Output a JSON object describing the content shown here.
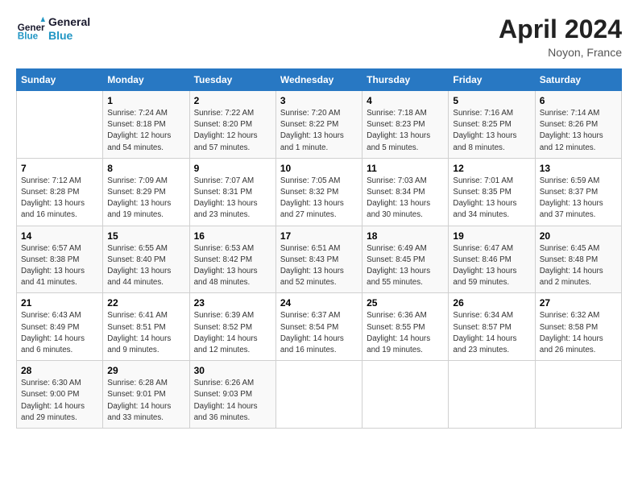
{
  "header": {
    "logo_line1": "General",
    "logo_line2": "Blue",
    "title": "April 2024",
    "subtitle": "Noyon, France"
  },
  "days_of_week": [
    "Sunday",
    "Monday",
    "Tuesday",
    "Wednesday",
    "Thursday",
    "Friday",
    "Saturday"
  ],
  "weeks": [
    [
      {
        "day": "",
        "info": ""
      },
      {
        "day": "1",
        "info": "Sunrise: 7:24 AM\nSunset: 8:18 PM\nDaylight: 12 hours\nand 54 minutes."
      },
      {
        "day": "2",
        "info": "Sunrise: 7:22 AM\nSunset: 8:20 PM\nDaylight: 12 hours\nand 57 minutes."
      },
      {
        "day": "3",
        "info": "Sunrise: 7:20 AM\nSunset: 8:22 PM\nDaylight: 13 hours\nand 1 minute."
      },
      {
        "day": "4",
        "info": "Sunrise: 7:18 AM\nSunset: 8:23 PM\nDaylight: 13 hours\nand 5 minutes."
      },
      {
        "day": "5",
        "info": "Sunrise: 7:16 AM\nSunset: 8:25 PM\nDaylight: 13 hours\nand 8 minutes."
      },
      {
        "day": "6",
        "info": "Sunrise: 7:14 AM\nSunset: 8:26 PM\nDaylight: 13 hours\nand 12 minutes."
      }
    ],
    [
      {
        "day": "7",
        "info": "Sunrise: 7:12 AM\nSunset: 8:28 PM\nDaylight: 13 hours\nand 16 minutes."
      },
      {
        "day": "8",
        "info": "Sunrise: 7:09 AM\nSunset: 8:29 PM\nDaylight: 13 hours\nand 19 minutes."
      },
      {
        "day": "9",
        "info": "Sunrise: 7:07 AM\nSunset: 8:31 PM\nDaylight: 13 hours\nand 23 minutes."
      },
      {
        "day": "10",
        "info": "Sunrise: 7:05 AM\nSunset: 8:32 PM\nDaylight: 13 hours\nand 27 minutes."
      },
      {
        "day": "11",
        "info": "Sunrise: 7:03 AM\nSunset: 8:34 PM\nDaylight: 13 hours\nand 30 minutes."
      },
      {
        "day": "12",
        "info": "Sunrise: 7:01 AM\nSunset: 8:35 PM\nDaylight: 13 hours\nand 34 minutes."
      },
      {
        "day": "13",
        "info": "Sunrise: 6:59 AM\nSunset: 8:37 PM\nDaylight: 13 hours\nand 37 minutes."
      }
    ],
    [
      {
        "day": "14",
        "info": "Sunrise: 6:57 AM\nSunset: 8:38 PM\nDaylight: 13 hours\nand 41 minutes."
      },
      {
        "day": "15",
        "info": "Sunrise: 6:55 AM\nSunset: 8:40 PM\nDaylight: 13 hours\nand 44 minutes."
      },
      {
        "day": "16",
        "info": "Sunrise: 6:53 AM\nSunset: 8:42 PM\nDaylight: 13 hours\nand 48 minutes."
      },
      {
        "day": "17",
        "info": "Sunrise: 6:51 AM\nSunset: 8:43 PM\nDaylight: 13 hours\nand 52 minutes."
      },
      {
        "day": "18",
        "info": "Sunrise: 6:49 AM\nSunset: 8:45 PM\nDaylight: 13 hours\nand 55 minutes."
      },
      {
        "day": "19",
        "info": "Sunrise: 6:47 AM\nSunset: 8:46 PM\nDaylight: 13 hours\nand 59 minutes."
      },
      {
        "day": "20",
        "info": "Sunrise: 6:45 AM\nSunset: 8:48 PM\nDaylight: 14 hours\nand 2 minutes."
      }
    ],
    [
      {
        "day": "21",
        "info": "Sunrise: 6:43 AM\nSunset: 8:49 PM\nDaylight: 14 hours\nand 6 minutes."
      },
      {
        "day": "22",
        "info": "Sunrise: 6:41 AM\nSunset: 8:51 PM\nDaylight: 14 hours\nand 9 minutes."
      },
      {
        "day": "23",
        "info": "Sunrise: 6:39 AM\nSunset: 8:52 PM\nDaylight: 14 hours\nand 12 minutes."
      },
      {
        "day": "24",
        "info": "Sunrise: 6:37 AM\nSunset: 8:54 PM\nDaylight: 14 hours\nand 16 minutes."
      },
      {
        "day": "25",
        "info": "Sunrise: 6:36 AM\nSunset: 8:55 PM\nDaylight: 14 hours\nand 19 minutes."
      },
      {
        "day": "26",
        "info": "Sunrise: 6:34 AM\nSunset: 8:57 PM\nDaylight: 14 hours\nand 23 minutes."
      },
      {
        "day": "27",
        "info": "Sunrise: 6:32 AM\nSunset: 8:58 PM\nDaylight: 14 hours\nand 26 minutes."
      }
    ],
    [
      {
        "day": "28",
        "info": "Sunrise: 6:30 AM\nSunset: 9:00 PM\nDaylight: 14 hours\nand 29 minutes."
      },
      {
        "day": "29",
        "info": "Sunrise: 6:28 AM\nSunset: 9:01 PM\nDaylight: 14 hours\nand 33 minutes."
      },
      {
        "day": "30",
        "info": "Sunrise: 6:26 AM\nSunset: 9:03 PM\nDaylight: 14 hours\nand 36 minutes."
      },
      {
        "day": "",
        "info": ""
      },
      {
        "day": "",
        "info": ""
      },
      {
        "day": "",
        "info": ""
      },
      {
        "day": "",
        "info": ""
      }
    ]
  ]
}
